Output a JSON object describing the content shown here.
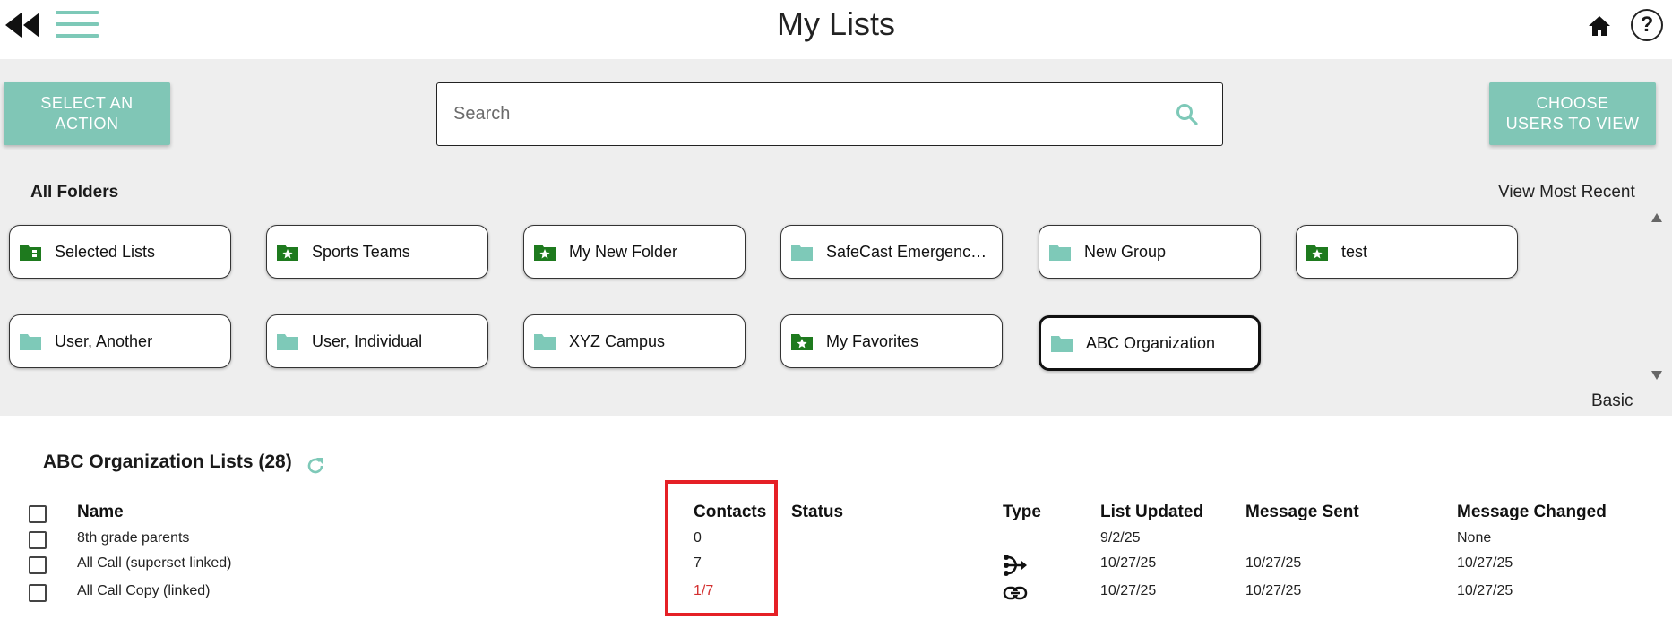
{
  "header": {
    "title": "My Lists"
  },
  "toolbar": {
    "select_action_label": "SELECT AN ACTION",
    "search_placeholder": "Search",
    "search_value": "",
    "choose_users_label": "CHOOSE USERS TO VIEW"
  },
  "folders": {
    "heading": "All Folders",
    "view_recent": "View Most Recent",
    "basic_label": "Basic",
    "items": [
      {
        "label": "Selected Lists",
        "icon": "selected-lists-folder-icon"
      },
      {
        "label": "Sports Teams",
        "icon": "star-folder-icon"
      },
      {
        "label": "My New Folder",
        "icon": "star-folder-icon"
      },
      {
        "label": "SafeCast Emergenc…",
        "icon": "folder-icon"
      },
      {
        "label": "New Group",
        "icon": "folder-icon"
      },
      {
        "label": "test",
        "icon": "star-folder-icon"
      },
      {
        "label": "User, Another",
        "icon": "folder-icon"
      },
      {
        "label": "User, Individual",
        "icon": "folder-icon"
      },
      {
        "label": "XYZ Campus",
        "icon": "folder-icon"
      },
      {
        "label": "My Favorites",
        "icon": "star-folder-icon"
      },
      {
        "label": "ABC Organization",
        "icon": "folder-icon",
        "selected": true
      }
    ]
  },
  "lists": {
    "title": "ABC Organization Lists (28)",
    "columns": {
      "name": "Name",
      "contacts": "Contacts",
      "status": "Status",
      "type": "Type",
      "list_updated": "List Updated",
      "message_sent": "Message Sent",
      "message_changed": "Message Changed"
    },
    "rows": [
      {
        "name": "8th grade parents",
        "contacts": "0",
        "status": "",
        "type_icon": "",
        "list_updated": "9/2/25",
        "message_sent": "",
        "message_changed": "None"
      },
      {
        "name": "All Call (superset linked)",
        "contacts": "7",
        "status": "",
        "type_icon": "superset-icon",
        "list_updated": "10/27/25",
        "message_sent": "10/27/25",
        "message_changed": "10/27/25"
      },
      {
        "name": "All Call Copy (linked)",
        "contacts": "1/7",
        "contacts_color": "#d32f2f",
        "status": "",
        "type_icon": "link-icon",
        "list_updated": "10/27/25",
        "message_sent": "10/27/25",
        "message_changed": "10/27/25"
      }
    ]
  },
  "colors": {
    "accent": "#80c6b6",
    "folder_teal": "#7ec9b8",
    "folder_green": "#1e7a1e",
    "highlight": "#e52026"
  }
}
